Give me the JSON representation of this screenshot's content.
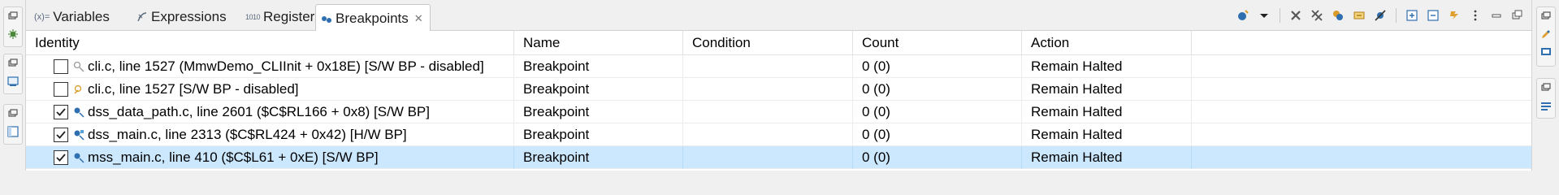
{
  "tabs": [
    {
      "label": "Variables",
      "icon": "variables-icon",
      "prefix": "(x)="
    },
    {
      "label": "Expressions",
      "icon": "expressions-icon"
    },
    {
      "label": "Registers",
      "icon": "registers-icon",
      "prefix": "1010"
    },
    {
      "label": "Breakpoints",
      "icon": "breakpoints-icon",
      "active": true
    }
  ],
  "columns": [
    "Identity",
    "Name",
    "Condition",
    "Count",
    "Action"
  ],
  "rows": [
    {
      "checked": false,
      "identity": "cli.c, line 1527 (MmwDemo_CLIInit + 0x18E)  [S/W BP - disabled]",
      "name": "Breakpoint",
      "condition": "",
      "count": "0 (0)",
      "action": "Remain Halted",
      "icon": "breakpoint-disabled-icon"
    },
    {
      "checked": false,
      "identity": "cli.c, line 1527 [S/W BP - disabled]",
      "name": "Breakpoint",
      "condition": "",
      "count": "0 (0)",
      "action": "Remain Halted",
      "icon": "breakpoint-disabled-icon"
    },
    {
      "checked": true,
      "identity": "dss_data_path.c, line 2601 ($C$RL166 + 0x8)  [S/W BP]",
      "name": "Breakpoint",
      "condition": "",
      "count": "0 (0)",
      "action": "Remain Halted",
      "icon": "breakpoint-icon"
    },
    {
      "checked": true,
      "identity": "dss_main.c, line 2313 ($C$RL424 + 0x42)  [H/W BP]",
      "name": "Breakpoint",
      "condition": "",
      "count": "0 (0)",
      "action": "Remain Halted",
      "icon": "breakpoint-icon"
    },
    {
      "checked": true,
      "identity": "mss_main.c, line 410 ($C$L61 + 0xE)  [S/W BP]",
      "name": "Breakpoint",
      "condition": "",
      "count": "0 (0)",
      "action": "Remain Halted",
      "icon": "breakpoint-icon",
      "selected": true
    }
  ],
  "toolbar": [
    "new-breakpoint-icon",
    "dropdown-icon",
    "remove-icon",
    "remove-all-icon",
    "group-icon",
    "link-icon",
    "skip-all-icon",
    "expand-all-icon",
    "collapse-all-icon",
    "link-with-editor-icon",
    "view-menu-icon",
    "minimize-icon",
    "maximize-icon"
  ],
  "colors": {
    "selection": "#cce8ff",
    "accent": "#2f6fb0"
  }
}
